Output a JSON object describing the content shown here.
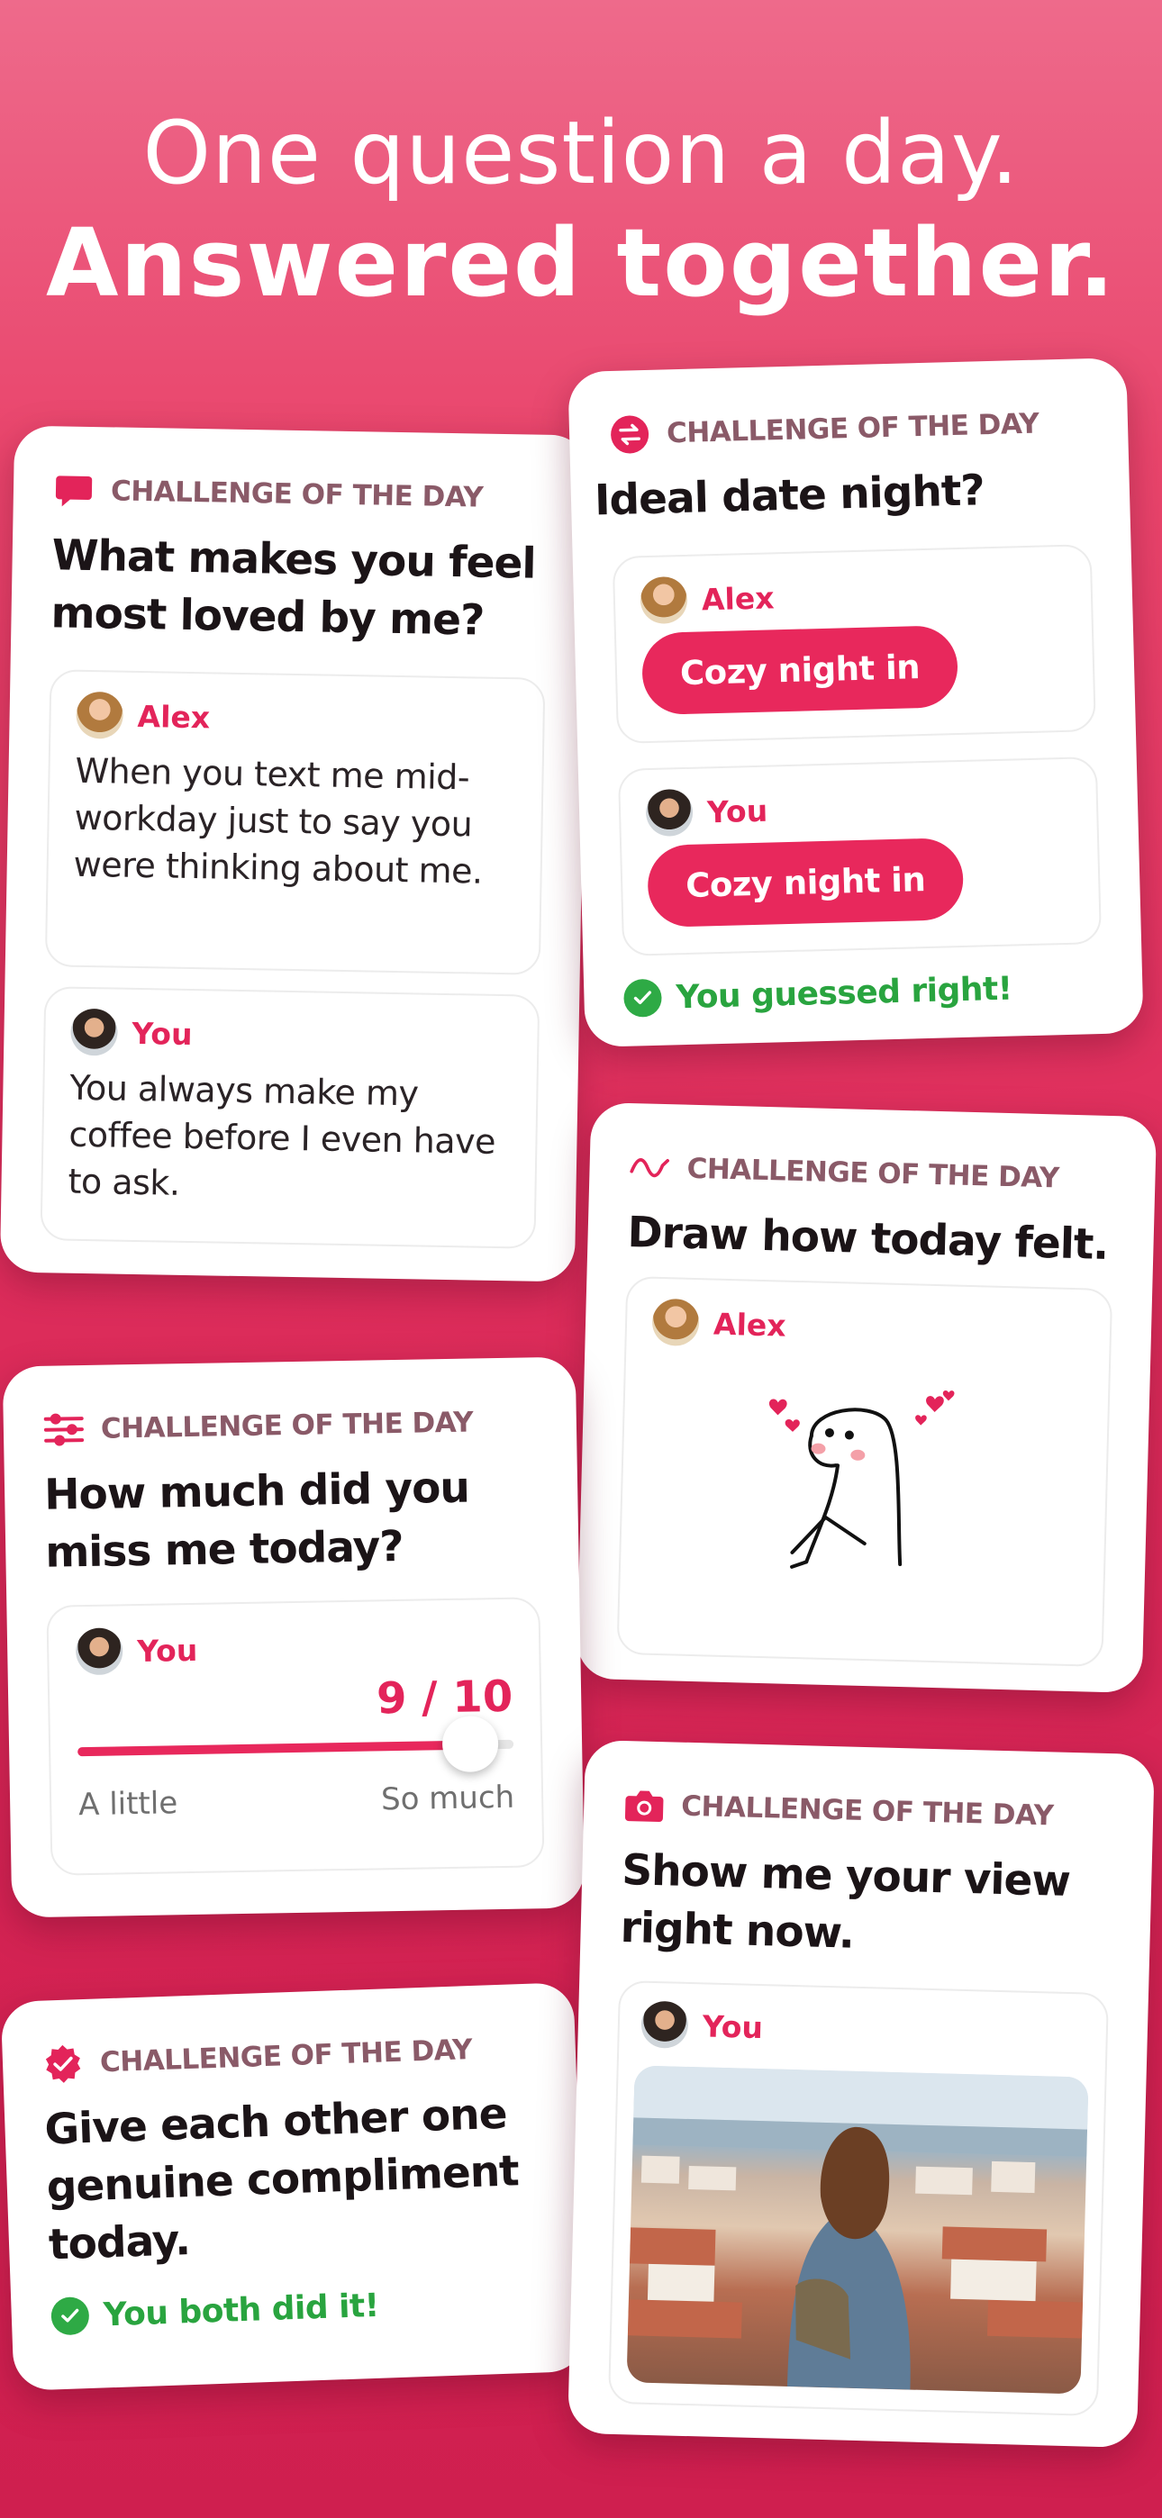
{
  "headline": {
    "line1": "One question a day.",
    "line2": "Answered together."
  },
  "colors": {
    "brand": "#e8285c",
    "background_top": "#ee6a8b",
    "background_bottom": "#cf1f4f",
    "success": "#29a43f"
  },
  "cards": {
    "loved": {
      "label": "CHALLENGE OF THE DAY",
      "icon": "chat-bubble-icon",
      "question": "What makes you feel most loved by me?",
      "answers": [
        {
          "name": "Alex",
          "text": "When you text me mid-workday just to say you were thinking about me."
        },
        {
          "name": "You",
          "text": "You always make my coffee before I even have to ask."
        }
      ]
    },
    "date": {
      "label": "CHALLENGE OF THE DAY",
      "icon": "swap-arrows-icon",
      "question": "Ideal date night?",
      "answers": [
        {
          "name": "Alex",
          "choice": "Cozy night in"
        },
        {
          "name": "You",
          "choice": "Cozy night in"
        }
      ],
      "result": "You guessed right!"
    },
    "draw": {
      "label": "CHALLENGE OF THE DAY",
      "icon": "squiggle-icon",
      "question": "Draw how today felt.",
      "answer_name": "Alex"
    },
    "slider": {
      "label": "CHALLENGE OF THE DAY",
      "icon": "sliders-icon",
      "question": "How much did you miss me today?",
      "answer_name": "You",
      "value_text": "9 / 10",
      "value": 9,
      "max": 10,
      "min_label": "A little",
      "max_label": "So much"
    },
    "compliment": {
      "label": "CHALLENGE OF THE DAY",
      "icon": "verified-badge-icon",
      "question": "Give each other one genuine compliment today.",
      "result": "You both did it!"
    },
    "view": {
      "label": "CHALLENGE OF THE DAY",
      "icon": "camera-icon",
      "question": "Show me your view right now.",
      "answer_name": "You"
    }
  }
}
